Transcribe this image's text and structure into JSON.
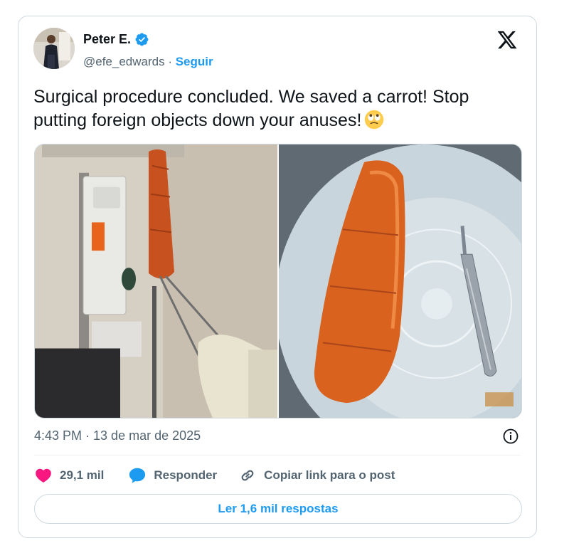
{
  "author": {
    "display_name": "Peter E.",
    "handle": "@efe_edwards",
    "separator": " · ",
    "follow_label": "Seguir"
  },
  "tweet": {
    "text": "Surgical procedure concluded. We saved a carrot! Stop putting foreign objects down your anuses!",
    "emoji": "face-with-rolling-eyes"
  },
  "timestamp": "4:43 PM · 13 de mar de 2025",
  "actions": {
    "likes": "29,1 mil",
    "reply_label": "Responder",
    "copy_link_label": "Copiar link para o post"
  },
  "read_replies_label": "Ler 1,6 mil respostas",
  "colors": {
    "accent": "#1d9bf0",
    "like": "#f91880",
    "text_primary": "#0f1419",
    "text_secondary": "#536471",
    "border": "#cfd9de"
  },
  "icons": {
    "verified": "verified-badge-icon",
    "logo": "x-logo-icon",
    "info": "info-icon",
    "like": "heart-icon",
    "reply": "speech-bubble-icon",
    "link": "link-icon"
  }
}
